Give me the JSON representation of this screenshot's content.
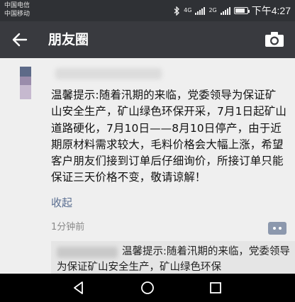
{
  "status_bar": {
    "carrier_1": "中国电信",
    "carrier_2": "中国移动",
    "net_small_1": "4G",
    "net_small_2": "2G",
    "time": "下午4:27",
    "icons": [
      "bluetooth-icon",
      "signal-icon",
      "signal-icon",
      "battery-icon"
    ]
  },
  "header": {
    "title": "朋友圈",
    "back_icon": "arrow-left-icon",
    "camera_icon": "camera-icon"
  },
  "post": {
    "text": "温馨提示:随着汛期的来临，党委领导为保证矿山安全生产，矿山绿色环保开采，7月1日起矿山道路硬化，7月10日——8月10日停产，由于近期原材料需求较大，毛料价格会大幅上涨，希望客户朋友们接到订单后仔细询价，所接订单只能保证三天价格不变，敬请谅解！",
    "collapse_label": "收起",
    "time": "1分钟前"
  },
  "comment": {
    "text": "温馨提示:随着汛期的来临，党委领导为保证矿山安全生产，矿山绿色环保"
  },
  "colors": {
    "status_bar": "#2f3135",
    "app_bar": "#393a3f",
    "link": "#596d90",
    "comment_button": "#8c98ad"
  }
}
